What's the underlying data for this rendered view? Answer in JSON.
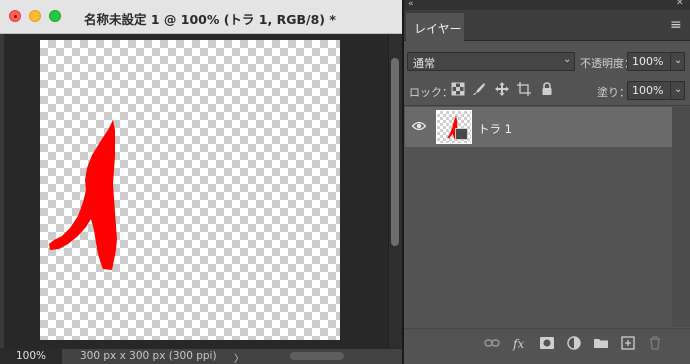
{
  "document": {
    "title": "名称未設定 1 @ 100% (トラ 1, RGB/8) *",
    "zoom": "100%",
    "info": "300 px x 300 px (300 ppi)",
    "info_chevron": "〉"
  },
  "layers_panel": {
    "tab_label": "レイヤー",
    "blend_mode": "通常",
    "opacity_label": "不透明度：",
    "opacity_value": "100%",
    "lock_label": "ロック：",
    "fill_label": "塗り：",
    "fill_value": "100%",
    "layers": [
      {
        "name": "トラ 1",
        "visible": true,
        "selected": true
      }
    ]
  },
  "colors": {
    "shape_fill": "#ff0000",
    "panel_bg": "#535353",
    "selected_row": "#6a6a6a"
  },
  "icons": {
    "footer": [
      "link-icon",
      "fx-icon",
      "mask-icon",
      "adjustment-icon",
      "folder-icon",
      "new-layer-icon",
      "trash-icon"
    ]
  }
}
